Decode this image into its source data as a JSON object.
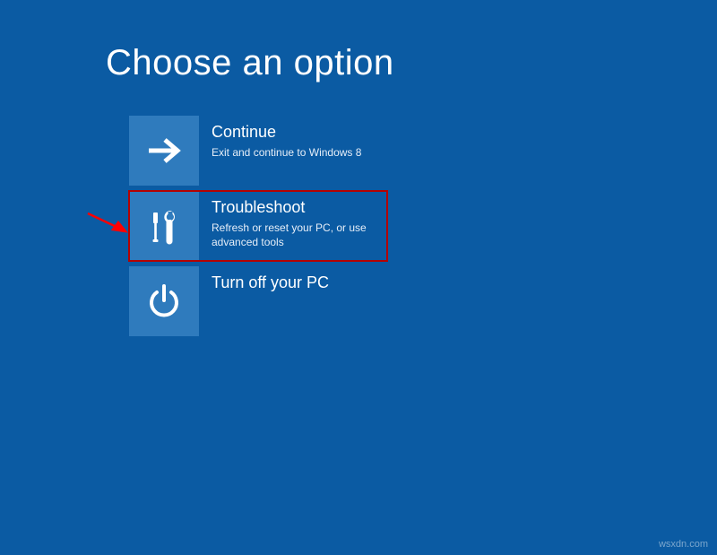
{
  "page": {
    "title": "Choose an option"
  },
  "options": [
    {
      "id": "continue",
      "title": "Continue",
      "desc": "Exit and continue to Windows 8",
      "highlight": false
    },
    {
      "id": "troubleshoot",
      "title": "Troubleshoot",
      "desc": "Refresh or reset your PC, or use advanced tools",
      "highlight": true
    },
    {
      "id": "turnoff",
      "title": "Turn off your PC",
      "desc": "",
      "highlight": false
    }
  ],
  "watermark": "wsxdn.com",
  "colors": {
    "background": "#0b5ba3",
    "tile": "#2f7bbd",
    "highlight": "#b40202",
    "arrow": "#ff0000"
  }
}
